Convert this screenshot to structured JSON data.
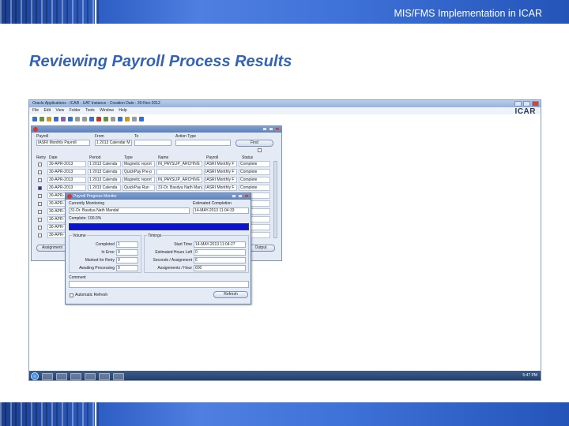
{
  "slide": {
    "header": "MIS/FMS Implementation in ICAR",
    "title": "Reviewing Payroll Process Results"
  },
  "app": {
    "window_title": "Oracle Applications - ICAR - UAT Instance - Creation Date : 30-Nov-2012",
    "menu": [
      "File",
      "Edit",
      "View",
      "Folder",
      "Tools",
      "Window",
      "Help"
    ],
    "logo": "ICAR"
  },
  "requests": {
    "labels": {
      "payroll": "Payroll",
      "from": "From",
      "to": "To",
      "action_type": "Action Type",
      "find": "Find",
      "retry": "Retry",
      "date": "Date",
      "period": "Period",
      "type": "Type",
      "name": "Name",
      "payroll_col": "Payroll",
      "status": "Status",
      "assignment_btn": "Assignment",
      "output_btn": "Output"
    },
    "payroll_value": "IASRI Monthly Payroll",
    "from_value": "1 2013 Calendar M",
    "rows": [
      {
        "date": "30-APR-2013",
        "period": "1 2013 Calenda",
        "type": "Magnetic report",
        "name": "IN_PAYSLIP_ARCHIVE",
        "payroll": "IASRI Monthly F",
        "status": "Complete"
      },
      {
        "date": "30-APR-2013",
        "period": "1 2013 Calenda",
        "type": "QuickPay Pre-p",
        "name": "",
        "payroll": "IASRI Monthly F",
        "status": "Complete"
      },
      {
        "date": "30-APR-2013",
        "period": "1 2013 Calenda",
        "type": "Magnetic report",
        "name": "IN_PAYSLIP_ARCHIVE",
        "payroll": "IASRI Monthly F",
        "status": "Complete"
      },
      {
        "date": "30-APR-2013",
        "period": "1 2013 Calenda",
        "type": "QuickPay Run",
        "name": "31-Dr. Basdya Nath Man",
        "payroll": "IASRI Monthly F",
        "status": "Complete"
      },
      {
        "date": "30-APR-",
        "period": "",
        "type": "",
        "name": "",
        "payroll": "",
        "status": "plete"
      },
      {
        "date": "30-APR-",
        "period": "",
        "type": "",
        "name": "",
        "payroll": "",
        "status": "plete"
      },
      {
        "date": "30-APR-",
        "period": "",
        "type": "",
        "name": "",
        "payroll": "",
        "status": "plete"
      },
      {
        "date": "30-APR-",
        "period": "",
        "type": "",
        "name": "",
        "payroll": "",
        "status": "plete"
      },
      {
        "date": "30-APR-",
        "period": "",
        "type": "",
        "name": "",
        "payroll": "",
        "status": "plete"
      },
      {
        "date": "30-APR-",
        "period": "",
        "type": "",
        "name": "",
        "payroll": "",
        "status": "plete"
      }
    ]
  },
  "monitor": {
    "title": "Payroll Progress Monitor",
    "currently_label": "Currently Monitoring",
    "currently_value": "31-Dr. Basdya Nath Mandal",
    "est_label": "Estimated Completion",
    "est_value": "14-MAY-2013 11:04:33",
    "complete_text": "Complete: 100.0%",
    "progress": 1.0,
    "volume_label": "Volume",
    "timings_label": "Timings",
    "volume": [
      {
        "label": "Completed",
        "value": "1"
      },
      {
        "label": "In Error",
        "value": "0"
      },
      {
        "label": "Marked for Retry",
        "value": "0"
      },
      {
        "label": "Awaiting Processing",
        "value": "0"
      }
    ],
    "timings": [
      {
        "label": "Start Time",
        "value": "14-MAY-2013 11:04:27"
      },
      {
        "label": "Estimated Hours Left",
        "value": "0"
      },
      {
        "label": "Seconds / Assignment",
        "value": "6"
      },
      {
        "label": "Assignments / Hour",
        "value": "600"
      }
    ],
    "comment_label": "Comment",
    "auto_refresh": "Automatic Refresh",
    "refresh_btn": "Refresh"
  },
  "taskbar": {
    "clock": "5:47 PM"
  }
}
